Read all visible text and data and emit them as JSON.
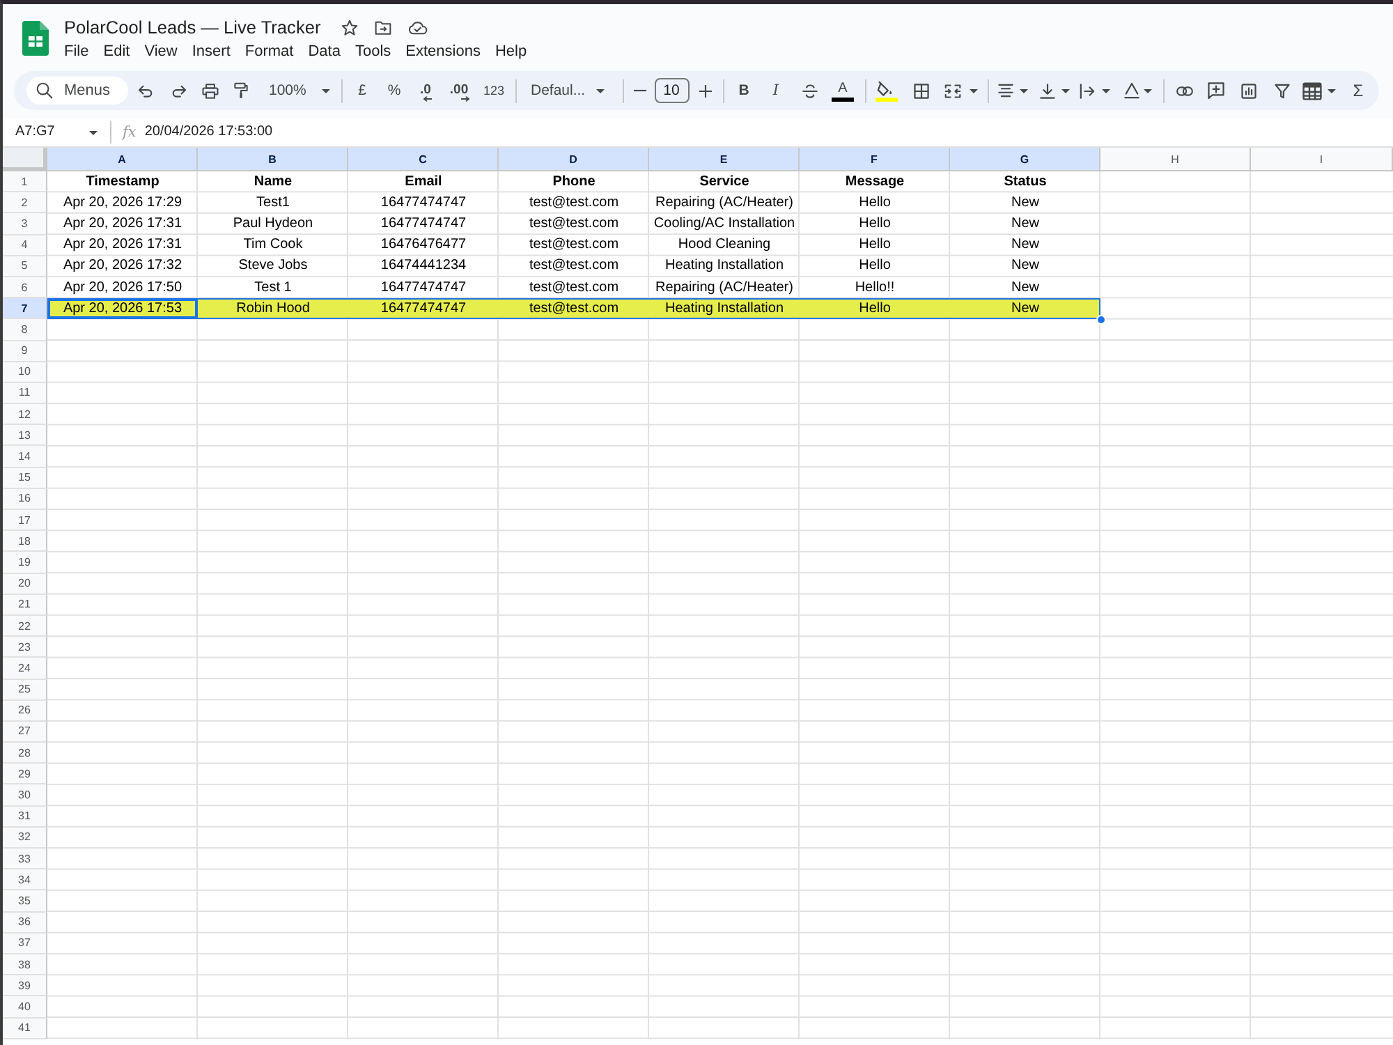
{
  "document": {
    "title": "PolarCool Leads — Live Tracker"
  },
  "menu": [
    "File",
    "Edit",
    "View",
    "Insert",
    "Format",
    "Data",
    "Tools",
    "Extensions",
    "Help"
  ],
  "toolbar": {
    "search": {
      "placeholder": "Menus"
    },
    "zoom": "100%",
    "currency": "£",
    "percent": "%",
    "decrease_decimal": ".0",
    "increase_decimal": ".00",
    "number_format": "123",
    "font": "Defaul...",
    "font_size": "10",
    "bold": "B",
    "italic": "I",
    "text_color": "A",
    "functions": "Σ"
  },
  "formula_bar": {
    "name_box": "A7:G7",
    "label": "fx",
    "formula": "20/04/2026 17:53:00"
  },
  "sheet": {
    "columns": [
      {
        "letter": "A",
        "selected": true
      },
      {
        "letter": "B",
        "selected": true
      },
      {
        "letter": "C",
        "selected": true
      },
      {
        "letter": "D",
        "selected": true
      },
      {
        "letter": "E",
        "selected": true
      },
      {
        "letter": "F",
        "selected": true
      },
      {
        "letter": "G",
        "selected": true
      },
      {
        "letter": "H",
        "selected": false
      },
      {
        "letter": "I",
        "selected": false
      }
    ],
    "rows": [
      {
        "number": "1",
        "kind": "header",
        "selected": false,
        "highlighted": false,
        "cells": [
          "Timestamp",
          "Name",
          "Email",
          "Phone",
          "Service",
          "Message",
          "Status"
        ]
      },
      {
        "number": "2",
        "kind": "data",
        "selected": false,
        "highlighted": false,
        "cells": [
          "Apr 20, 2026 17:29",
          "Test1",
          "16477474747",
          "test@test.com",
          "Repairing (AC/Heater)",
          "Hello",
          "New"
        ]
      },
      {
        "number": "3",
        "kind": "data",
        "selected": false,
        "highlighted": false,
        "cells": [
          "Apr 20, 2026 17:31",
          "Paul Hydeon",
          "16477474747",
          "test@test.com",
          "Cooling/AC Installation",
          "Hello",
          "New"
        ]
      },
      {
        "number": "4",
        "kind": "data",
        "selected": false,
        "highlighted": false,
        "cells": [
          "Apr 20, 2026 17:31",
          "Tim Cook",
          "16476476477",
          "test@test.com",
          "Hood Cleaning",
          "Hello",
          "New"
        ]
      },
      {
        "number": "5",
        "kind": "data",
        "selected": false,
        "highlighted": false,
        "cells": [
          "Apr 20, 2026 17:32",
          "Steve Jobs",
          "16474441234",
          "test@test.com",
          "Heating Installation",
          "Hello",
          "New"
        ]
      },
      {
        "number": "6",
        "kind": "data",
        "selected": false,
        "highlighted": false,
        "cells": [
          "Apr 20, 2026 17:50",
          "Test 1",
          "16477474747",
          "test@test.com",
          "Repairing (AC/Heater)",
          "Hello!!",
          "New"
        ]
      },
      {
        "number": "7",
        "kind": "data",
        "selected": true,
        "highlighted": true,
        "cells": [
          "Apr 20, 2026 17:53",
          "Robin Hood",
          "16477474747",
          "test@test.com",
          "Heating Installation",
          "Hello",
          "New"
        ]
      },
      {
        "number": "8",
        "kind": "data",
        "selected": false,
        "highlighted": false
      },
      {
        "number": "9",
        "kind": "data",
        "selected": false,
        "highlighted": false
      },
      {
        "number": "10",
        "kind": "data",
        "selected": false,
        "highlighted": false
      },
      {
        "number": "11",
        "kind": "data",
        "selected": false,
        "highlighted": false
      },
      {
        "number": "12",
        "kind": "data",
        "selected": false,
        "highlighted": false
      },
      {
        "number": "13",
        "kind": "data",
        "selected": false,
        "highlighted": false
      },
      {
        "number": "14",
        "kind": "data",
        "selected": false,
        "highlighted": false
      },
      {
        "number": "15",
        "kind": "data",
        "selected": false,
        "highlighted": false
      },
      {
        "number": "16",
        "kind": "data",
        "selected": false,
        "highlighted": false
      },
      {
        "number": "17",
        "kind": "data",
        "selected": false,
        "highlighted": false
      },
      {
        "number": "18",
        "kind": "data",
        "selected": false,
        "highlighted": false
      },
      {
        "number": "19",
        "kind": "data",
        "selected": false,
        "highlighted": false
      },
      {
        "number": "20",
        "kind": "data",
        "selected": false,
        "highlighted": false
      },
      {
        "number": "21",
        "kind": "data",
        "selected": false,
        "highlighted": false
      },
      {
        "number": "22",
        "kind": "data",
        "selected": false,
        "highlighted": false
      },
      {
        "number": "23",
        "kind": "data",
        "selected": false,
        "highlighted": false
      },
      {
        "number": "24",
        "kind": "data",
        "selected": false,
        "highlighted": false
      },
      {
        "number": "25",
        "kind": "data",
        "selected": false,
        "highlighted": false
      },
      {
        "number": "26",
        "kind": "data",
        "selected": false,
        "highlighted": false
      },
      {
        "number": "27",
        "kind": "data",
        "selected": false,
        "highlighted": false
      },
      {
        "number": "28",
        "kind": "data",
        "selected": false,
        "highlighted": false
      },
      {
        "number": "29",
        "kind": "data",
        "selected": false,
        "highlighted": false
      },
      {
        "number": "30",
        "kind": "data",
        "selected": false,
        "highlighted": false
      },
      {
        "number": "31",
        "kind": "data",
        "selected": false,
        "highlighted": false
      },
      {
        "number": "32",
        "kind": "data",
        "selected": false,
        "highlighted": false
      },
      {
        "number": "33",
        "kind": "data",
        "selected": false,
        "highlighted": false
      },
      {
        "number": "34",
        "kind": "data",
        "selected": false,
        "highlighted": false
      },
      {
        "number": "35",
        "kind": "data",
        "selected": false,
        "highlighted": false
      },
      {
        "number": "36",
        "kind": "data",
        "selected": false,
        "highlighted": false
      },
      {
        "number": "37",
        "kind": "data",
        "selected": false,
        "highlighted": false
      },
      {
        "number": "38",
        "kind": "data",
        "selected": false,
        "highlighted": false
      },
      {
        "number": "39",
        "kind": "data",
        "selected": false,
        "highlighted": false
      },
      {
        "number": "40",
        "kind": "data",
        "selected": false,
        "highlighted": false
      },
      {
        "number": "41",
        "kind": "data",
        "selected": false,
        "highlighted": false
      }
    ]
  }
}
